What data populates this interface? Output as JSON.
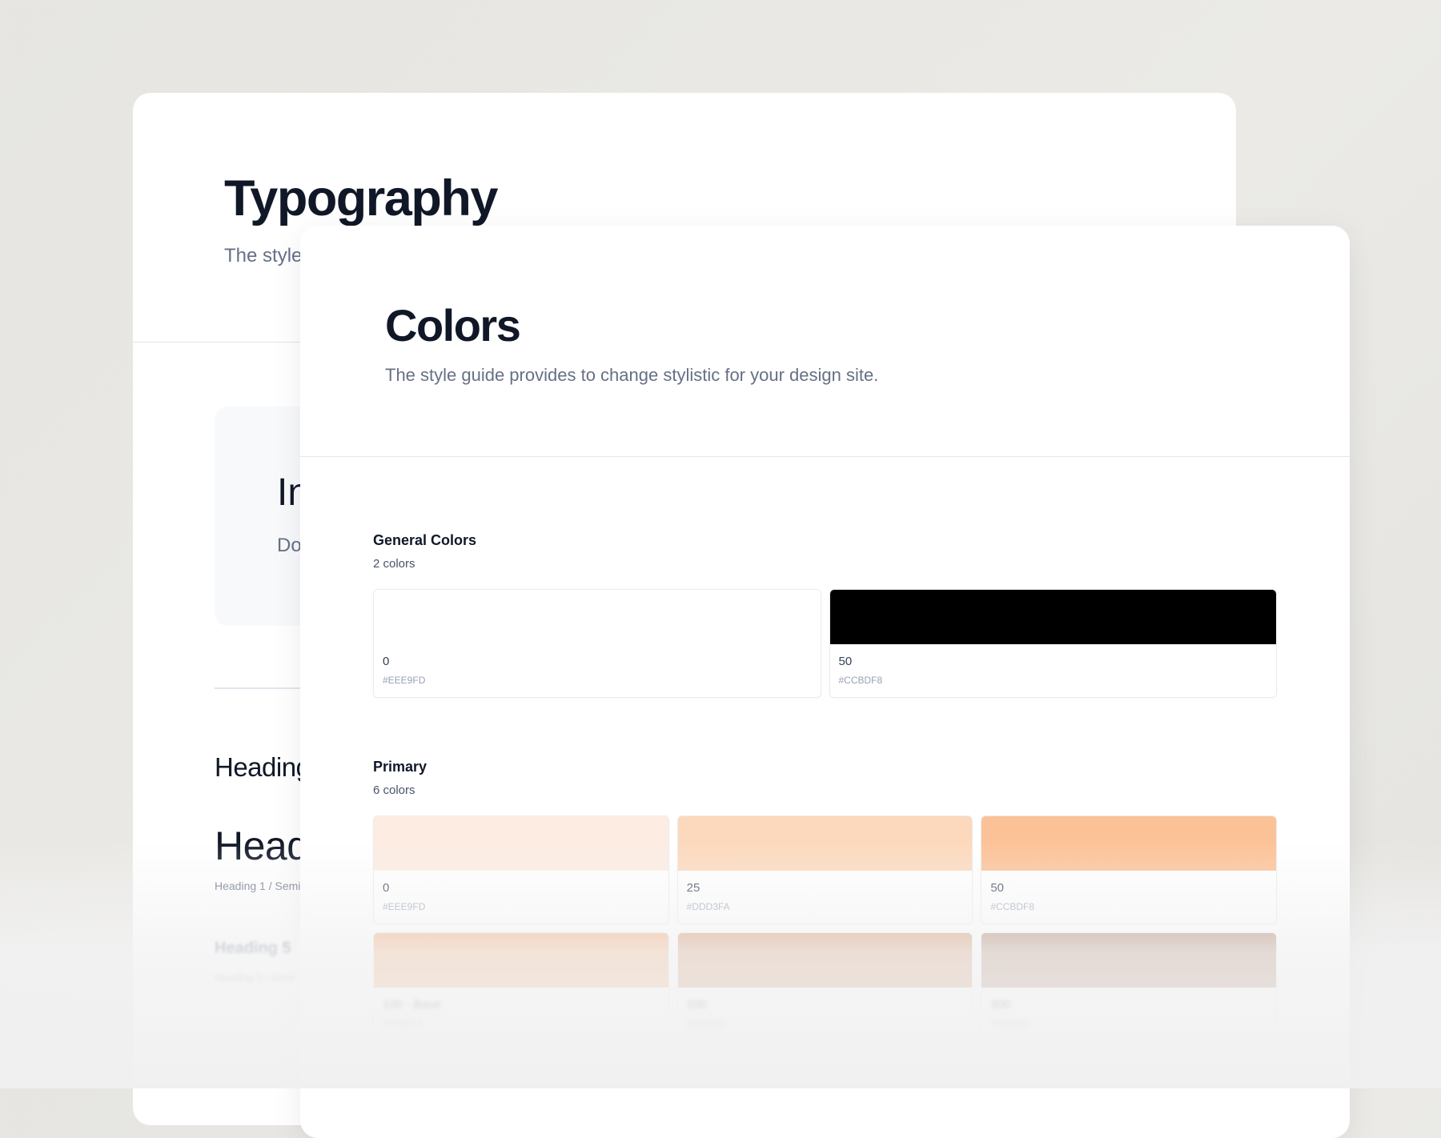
{
  "typography_card": {
    "title": "Typography",
    "subtitle_visible": "The style",
    "inter_title": "In",
    "inter_subtitle": "Do",
    "heading_small": "Heading",
    "heading_1": "Head",
    "heading_1_meta": "Heading 1 / Semib",
    "heading_5": "Heading 5",
    "heading_5_meta": "Heading 5 / Semi"
  },
  "colors_card": {
    "title": "Colors",
    "subtitle": "The style guide provides to change stylistic for your design site.",
    "sections": [
      {
        "title": "General Colors",
        "count": "2 colors",
        "swatches": [
          {
            "label": "0",
            "hex": "#EEE9FD",
            "color": "#ffffff"
          },
          {
            "label": "50",
            "hex": "#CCBDF8",
            "color": "#000000"
          }
        ]
      },
      {
        "title": "Primary",
        "count": "6 colors",
        "swatches": [
          {
            "label": "0",
            "hex": "#EEE9FD",
            "color": "#fcece2"
          },
          {
            "label": "25",
            "hex": "#DDD3FA",
            "color": "#fcd9bd"
          },
          {
            "label": "50",
            "hex": "#CCBDF8",
            "color": "#fcc297"
          },
          {
            "label": "100 - Base",
            "hex": "#AA91F3",
            "color": "#f4a36a"
          },
          {
            "label": "200",
            "hex": "#8864EE",
            "color": "#cf8a5b"
          },
          {
            "label": "300",
            "hex": "#6638E9",
            "color": "#a6765b"
          }
        ]
      }
    ]
  }
}
